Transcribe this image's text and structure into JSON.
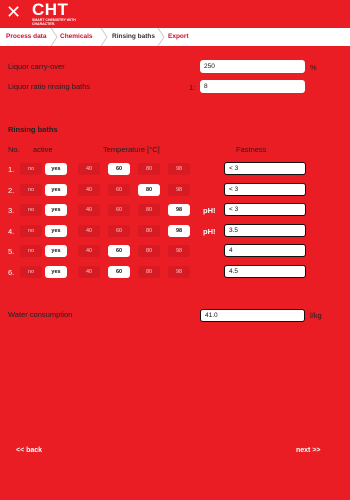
{
  "app": {
    "close_icon": "close-icon",
    "logo_text": "CHT",
    "logo_subtext": "SMART CHEMISTRY WITH CHARACTER."
  },
  "tabs": [
    {
      "label": "Process data",
      "active": false
    },
    {
      "label": "Chemicals",
      "active": false
    },
    {
      "label": "Rinsing baths",
      "active": true
    },
    {
      "label": "Export",
      "active": false
    }
  ],
  "liquor": {
    "carry_over_label": "Liquor carry-over",
    "carry_over_value": "250",
    "carry_over_unit": "%",
    "ratio_label": "Liquor ratio rinsing baths",
    "ratio_prefix": "1:",
    "ratio_value": "8"
  },
  "rinsing": {
    "section_title": "Rinsing baths",
    "col_no": "No.",
    "col_active": "active",
    "col_temperature": "Temperature [°C]",
    "col_fastness": "Fastness",
    "rows": [
      {
        "no": "1.",
        "no_label": "no",
        "yes_label": "yes",
        "temps": [
          "40",
          "60",
          "80",
          "98"
        ],
        "selected_temp": 1,
        "ph": "",
        "fastness": "< 3"
      },
      {
        "no": "2.",
        "no_label": "no",
        "yes_label": "yes",
        "temps": [
          "40",
          "60",
          "80",
          "98"
        ],
        "selected_temp": 2,
        "ph": "",
        "fastness": "< 3"
      },
      {
        "no": "3.",
        "no_label": "no",
        "yes_label": "yes",
        "temps": [
          "40",
          "60",
          "80",
          "98"
        ],
        "selected_temp": 3,
        "ph": "pH!",
        "fastness": "< 3"
      },
      {
        "no": "4.",
        "no_label": "no",
        "yes_label": "yes",
        "temps": [
          "40",
          "60",
          "80",
          "98"
        ],
        "selected_temp": 3,
        "ph": "pH!",
        "fastness": "3.5"
      },
      {
        "no": "5.",
        "no_label": "no",
        "yes_label": "yes",
        "temps": [
          "40",
          "60",
          "80",
          "98"
        ],
        "selected_temp": 1,
        "ph": "",
        "fastness": "4"
      },
      {
        "no": "6.",
        "no_label": "no",
        "yes_label": "yes",
        "temps": [
          "40",
          "60",
          "80",
          "98"
        ],
        "selected_temp": 1,
        "ph": "",
        "fastness": "4.5"
      }
    ]
  },
  "water": {
    "label": "Water consumption",
    "value": "41.0",
    "unit": "l/kg"
  },
  "nav": {
    "back_label": "<< back",
    "next_label": "next >>"
  }
}
